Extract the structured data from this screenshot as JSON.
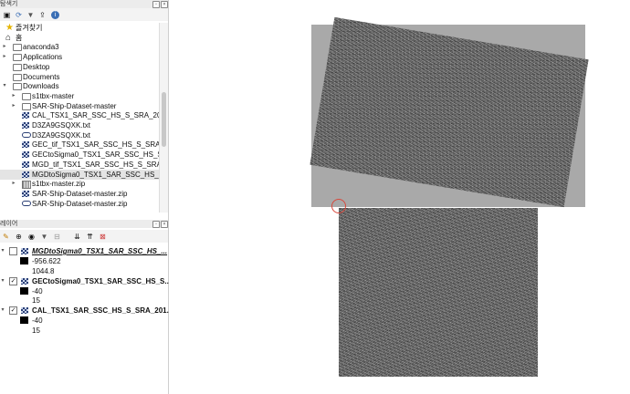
{
  "browser_panel": {
    "title": "탐색기",
    "tree": [
      {
        "label": "즐겨찾기",
        "icon": "star-icon",
        "arrow": ""
      },
      {
        "label": "홈",
        "icon": "home-icon",
        "arrow": "▾"
      },
      {
        "label": "anaconda3",
        "icon": "folder-icon",
        "arrow": "▸"
      },
      {
        "label": "Applications",
        "icon": "folder-icon",
        "arrow": "▸"
      },
      {
        "label": "Desktop",
        "icon": "folder-icon",
        "arrow": ""
      },
      {
        "label": "Documents",
        "icon": "folder-icon",
        "arrow": ""
      },
      {
        "label": "Downloads",
        "icon": "folder-icon",
        "arrow": "▾"
      },
      {
        "label": "s1tbx-master",
        "icon": "folder-icon",
        "arrow": "▸"
      },
      {
        "label": "SAR-Ship-Dataset-master",
        "icon": "folder-icon",
        "arrow": "▸"
      },
      {
        "label": "CAL_TSX1_SAR_SSC_HS_S_SRA_201",
        "icon": "raster-icon",
        "arrow": ""
      },
      {
        "label": "D3ZA9GSQXK.txt",
        "icon": "raster-icon",
        "arrow": ""
      },
      {
        "label": "D3ZA9GSQXK.txt",
        "icon": "vector-icon",
        "arrow": ""
      },
      {
        "label": "GEC_tif_TSX1_SAR_SSC_HS_S_SRA_",
        "icon": "raster-icon",
        "arrow": ""
      },
      {
        "label": "GECtoSigma0_TSX1_SAR_SSC_HS_S",
        "icon": "raster-icon",
        "arrow": ""
      },
      {
        "label": "MGD_tif_TSX1_SAR_SSC_HS_S_SRA_",
        "icon": "raster-icon",
        "arrow": ""
      },
      {
        "label": "MGDtoSigma0_TSX1_SAR_SSC_HS_S",
        "icon": "raster-icon",
        "arrow": ""
      },
      {
        "label": "s1tbx-master.zip",
        "icon": "zip-icon",
        "arrow": "▸"
      },
      {
        "label": "SAR-Ship-Dataset-master.zip",
        "icon": "raster-icon",
        "arrow": ""
      },
      {
        "label": "SAR-Ship-Dataset-master.zip",
        "icon": "vector-icon",
        "arrow": ""
      }
    ]
  },
  "layers_panel": {
    "title": "레이어",
    "layers": [
      {
        "name": "MGDtoSigma0_TSX1_SAR_SSC_HS_...",
        "checked": false,
        "min": "-956.622",
        "max": "1044.8"
      },
      {
        "name": "GECtoSigma0_TSX1_SAR_SSC_HS_S...",
        "checked": true,
        "min": "-40",
        "max": "15"
      },
      {
        "name": "CAL_TSX1_SAR_SSC_HS_S_SRA_201...",
        "checked": true,
        "min": "-40",
        "max": "15"
      }
    ]
  }
}
